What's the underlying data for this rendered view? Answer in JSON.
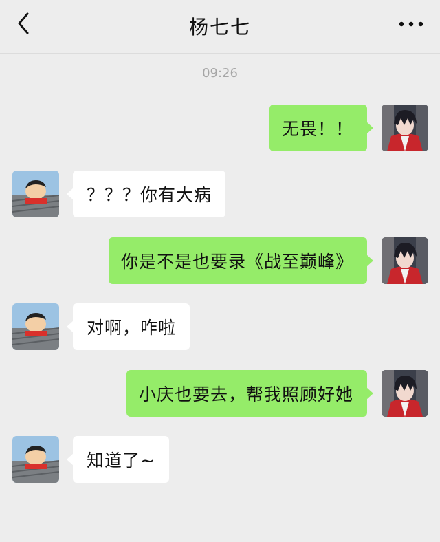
{
  "header": {
    "title": "杨七七",
    "back_icon": "chevron-left-icon",
    "more_icon": "more-dots-icon"
  },
  "timestamp": "09:26",
  "messages": [
    {
      "side": "sent",
      "text": "无畏！！"
    },
    {
      "side": "received",
      "text": "？？？你有大病"
    },
    {
      "side": "sent",
      "text": "你是不是也要录《战至巅峰》"
    },
    {
      "side": "received",
      "text": "对啊，咋啦"
    },
    {
      "side": "sent",
      "text": "小庆也要去，帮我照顾好她"
    },
    {
      "side": "received",
      "text": "知道了~"
    }
  ],
  "colors": {
    "sent_bubble": "#95ec69",
    "received_bubble": "#ffffff",
    "background": "#ededed"
  }
}
